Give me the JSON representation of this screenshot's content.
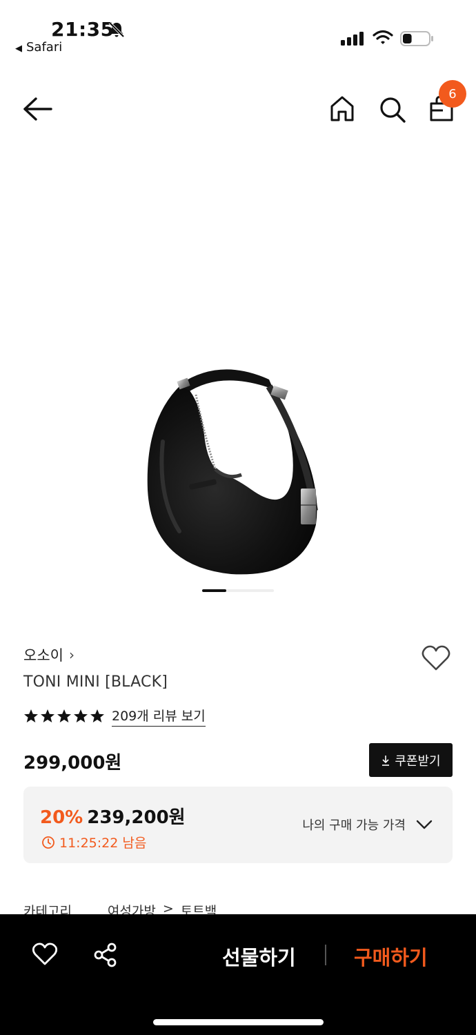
{
  "status_bar": {
    "time": "21:35",
    "back_app": "Safari",
    "battery_level": 0.35
  },
  "nav": {
    "cart_count": "6"
  },
  "product": {
    "brand": "오소이",
    "brand_chevron": "›",
    "title": "TONI MINI [BLACK]",
    "rating_stars": 5,
    "review_link": "209개 리뷰 보기",
    "price": "299,000원",
    "coupon_label": "쿠폰받기",
    "image_count_indicator": {
      "active_index": 0
    }
  },
  "offer": {
    "discount_pct": "20%",
    "sale_price": "239,200원",
    "timer": "11:25:22 남음",
    "my_price_label": "나의 구매 가능 가격"
  },
  "category": {
    "label": "카테고리",
    "path_1": "여성가방",
    "separator": ">",
    "path_2": "토트백"
  },
  "bottom_bar": {
    "gift_label": "선물하기",
    "buy_label": "구매하기"
  },
  "colors": {
    "accent": "#f25a1d",
    "dark": "#111111",
    "offer_bg": "#f3f3f3"
  },
  "icons": [
    "back-arrow-icon",
    "home-icon",
    "search-icon",
    "shopping-bag-icon",
    "heart-icon",
    "share-icon",
    "star-icon",
    "download-icon",
    "clock-icon",
    "chevron-down-icon",
    "mute-bell-icon",
    "signal-icon",
    "wifi-icon",
    "battery-icon"
  ]
}
